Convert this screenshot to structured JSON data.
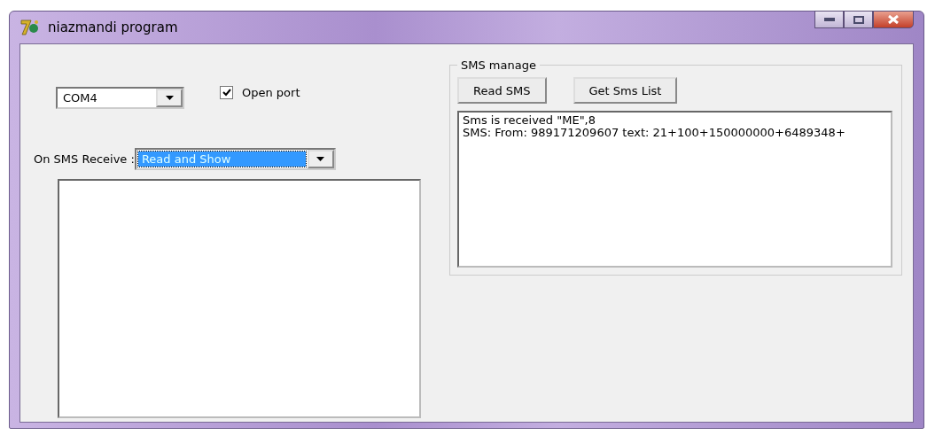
{
  "window": {
    "title": "niazmandi program"
  },
  "port_select": {
    "value": "COM4"
  },
  "open_port": {
    "label": "Open port",
    "checked": true
  },
  "on_receive": {
    "label": "On SMS Receive :",
    "value": "Read and Show",
    "highlighted": true
  },
  "sms_manage": {
    "title": "SMS manage",
    "buttons": [
      "Read SMS",
      "Get Sms List"
    ],
    "lines": [
      "Sms is received \"ME\",8",
      "SMS: From: 989171209607 text: 21+100+150000000+6489348+"
    ]
  }
}
